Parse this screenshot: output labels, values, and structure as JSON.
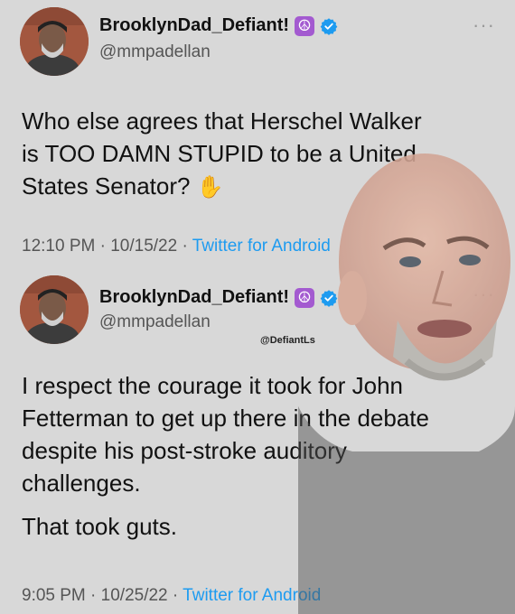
{
  "tweets": [
    {
      "display_name": "BrooklynDad_Defiant!",
      "handle": "@mmpadellan",
      "body": "Who else agrees that Herschel Walker\nis TOO DAMN STUPID to be a United\nStates Senator?",
      "emoji": "✋",
      "time": "12:10 PM",
      "date": "10/15/22",
      "source": "Twitter for Android"
    },
    {
      "display_name": "BrooklynDad_Defiant!",
      "handle": "@mmpadellan",
      "paragraphs": [
        "I respect the courage it took for John\nFetterman to get up there in the debate\ndespite his post-stroke auditory\nchallenges.",
        "That took guts."
      ],
      "time": "9:05 PM",
      "date": "10/25/22",
      "source": "Twitter for Android"
    }
  ],
  "badges": {
    "peace_symbol": "☮"
  },
  "separator": " · ",
  "more_glyph": "···",
  "watermark": "@DefiantLs",
  "colors": {
    "link": "#1d9bf0",
    "verified": "#1d9bf0",
    "peace_badge": "#a35ad0"
  }
}
